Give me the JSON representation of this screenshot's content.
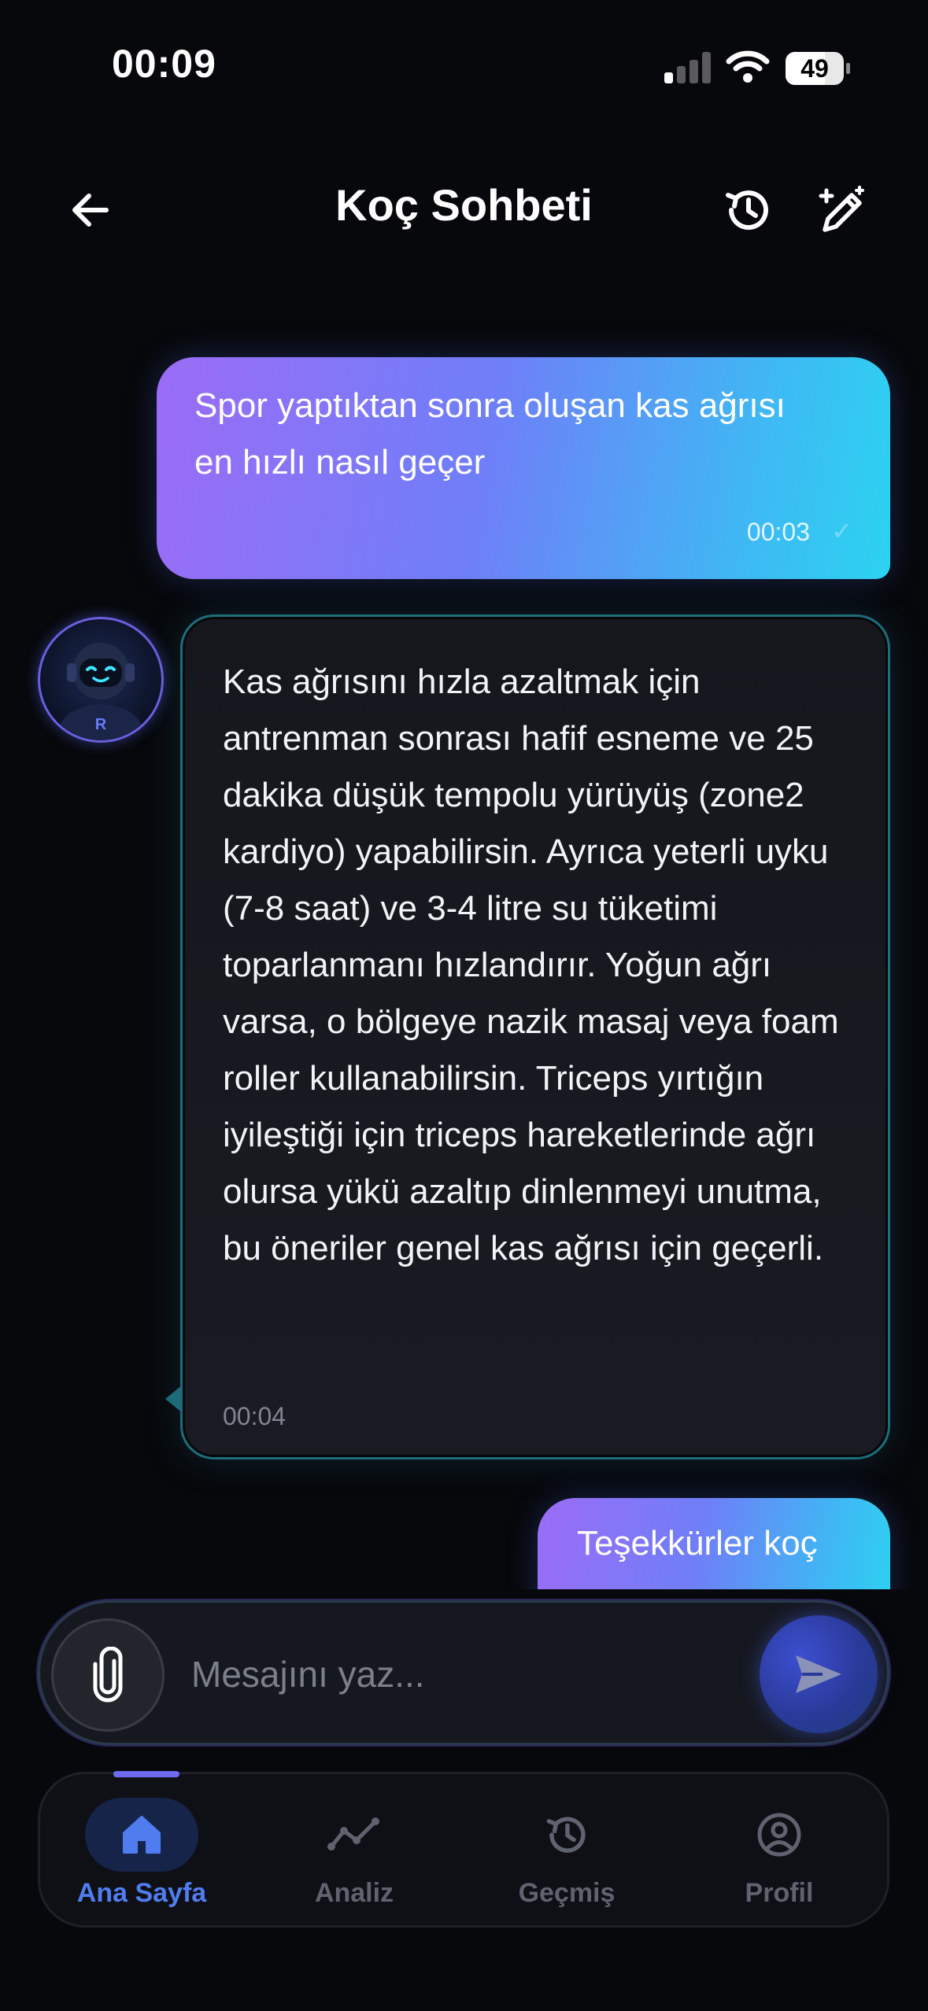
{
  "status_bar": {
    "time": "00:09",
    "battery": "49"
  },
  "header": {
    "title": "Koç Sohbeti"
  },
  "messages": [
    {
      "role": "user",
      "text": "Spor yaptıktan sonra oluşan kas ağrısı en hızlı nasıl geçer",
      "time": "00:03"
    },
    {
      "role": "coach",
      "text": "Kas ağrısını hızla azaltmak için antrenman sonrası hafif esneme ve 25 dakika düşük tempolu yürüyüş (zone2 kardiyo) yapabilirsin. Ayrıca yeterli uyku (7-8 saat) ve 3-4 litre su tüketimi toparlanmanı hızlandırır. Yoğun ağrı varsa, o bölgeye nazik masaj veya foam roller kullanabilirsin. Triceps yırtığın iyileştiği için triceps hareketlerinde ağrı olursa yükü azaltıp dinlenmeyi unutma, bu öneriler genel kas ağrısı için geçerli.",
      "time": "00:04"
    },
    {
      "role": "user",
      "text": "Teşekkürler koç"
    }
  ],
  "composer": {
    "placeholder": "Mesajını yaz..."
  },
  "tabs": [
    {
      "label": "Ana Sayfa",
      "icon": "home-icon",
      "active": true
    },
    {
      "label": "Analiz",
      "icon": "chart-line-icon"
    },
    {
      "label": "Geçmiş",
      "icon": "history-icon"
    },
    {
      "label": "Profil",
      "icon": "user-circle-icon"
    }
  ],
  "colors": {
    "accent": "#4f7df0",
    "user_bubble_start": "#9b6cf6",
    "user_bubble_end": "#2cd3f0",
    "background": "#07080b"
  }
}
